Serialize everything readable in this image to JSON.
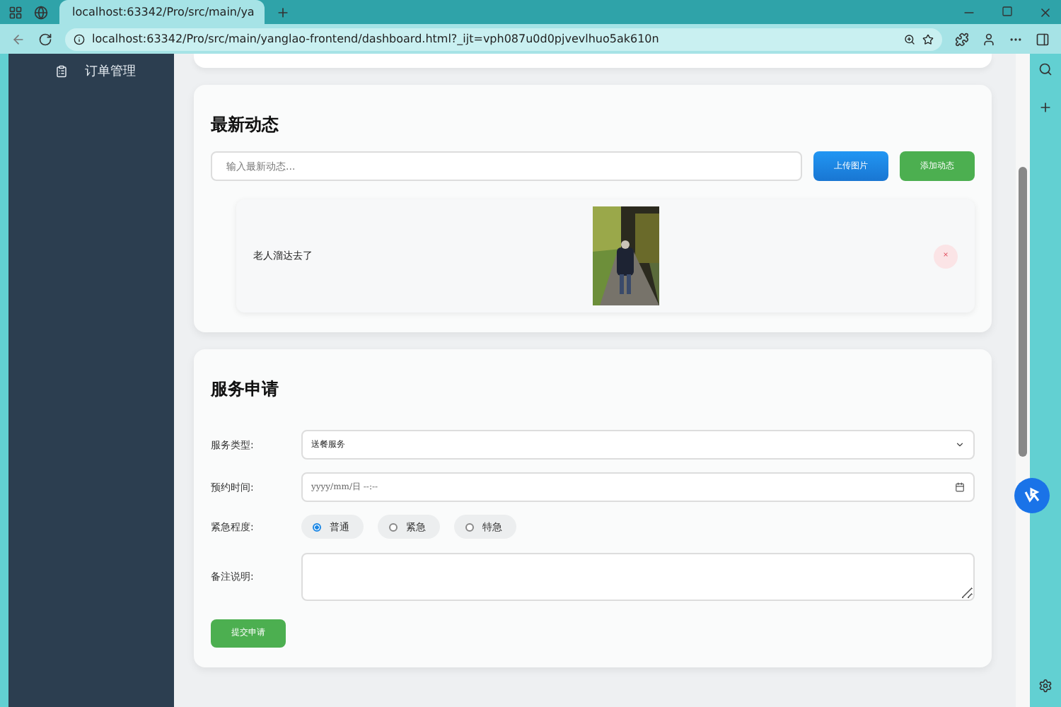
{
  "browser": {
    "tab_title": "localhost:63342/Pro/src/main/ya",
    "url": "localhost:63342/Pro/src/main/yanglao-frontend/dashboard.html?_ijt=vph087u0d0pjvevlhuo5ak610n"
  },
  "sidebar": {
    "items": [
      {
        "label": "订单管理",
        "selected": false
      }
    ]
  },
  "news": {
    "title": "最新动态",
    "input": {
      "placeholder": "输入最新动态..."
    },
    "upload_button": "上传图片",
    "add_button": "添加动态",
    "posts": [
      {
        "text": "老人溜达去了",
        "delete": "×"
      }
    ]
  },
  "service": {
    "title": "服务申请",
    "fields": [
      {
        "kind": "select",
        "label": "服务类型:",
        "value": "送餐服务"
      },
      {
        "kind": "datetime",
        "label": "预约时间:",
        "placeholder": "yyyy/mm/日 --:--"
      },
      {
        "kind": "radio",
        "label": "紧急程度:",
        "options": [
          {
            "label": "普通",
            "selected": true
          },
          {
            "label": "紧急",
            "selected": false
          },
          {
            "label": "特急",
            "selected": false
          }
        ]
      },
      {
        "kind": "textarea",
        "label": "备注说明:"
      }
    ],
    "submit": "提交申请"
  }
}
